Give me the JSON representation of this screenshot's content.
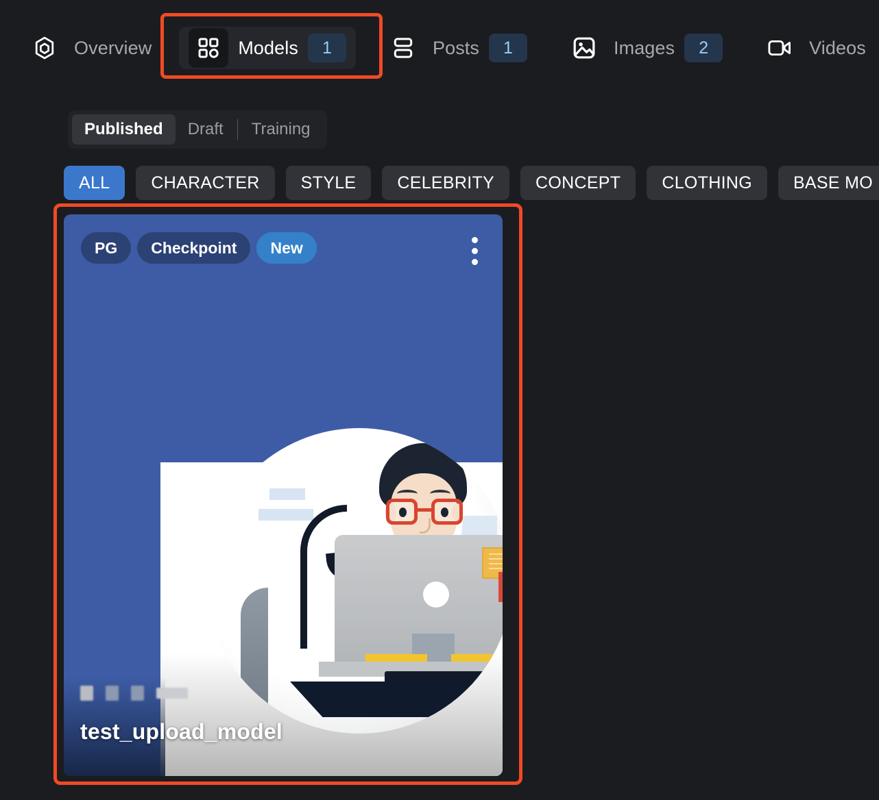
{
  "nav": {
    "items": [
      {
        "label": "Overview",
        "icon": "hexagon-icon",
        "badge": null,
        "active": false
      },
      {
        "label": "Models",
        "icon": "grid-icon",
        "badge": "1",
        "active": true
      },
      {
        "label": "Posts",
        "icon": "posts-icon",
        "badge": "1",
        "active": false
      },
      {
        "label": "Images",
        "icon": "image-icon",
        "badge": "2",
        "active": false
      },
      {
        "label": "Videos",
        "icon": "video-icon",
        "badge": null,
        "active": false
      }
    ]
  },
  "status_tabs": {
    "items": [
      {
        "label": "Published",
        "active": true
      },
      {
        "label": "Draft",
        "active": false
      },
      {
        "label": "Training",
        "active": false
      }
    ]
  },
  "filters": {
    "chips": [
      {
        "label": "ALL",
        "active": true
      },
      {
        "label": "CHARACTER",
        "active": false
      },
      {
        "label": "STYLE",
        "active": false
      },
      {
        "label": "CELEBRITY",
        "active": false
      },
      {
        "label": "CONCEPT",
        "active": false
      },
      {
        "label": "CLOTHING",
        "active": false
      },
      {
        "label": "BASE MO",
        "active": false
      }
    ]
  },
  "model_card": {
    "badges": [
      {
        "label": "PG",
        "style": "dark"
      },
      {
        "label": "Checkpoint",
        "style": "dark"
      },
      {
        "label": "New",
        "style": "accent"
      }
    ],
    "menu_icon": "kebab-menu-icon",
    "title": "test_upload_model"
  },
  "colors": {
    "page_background": "#1b1c20",
    "accent_blue": "#3b78cc",
    "card_blue": "#3d5ca5",
    "badge_navy": "#24364c",
    "badge_text": "#9ecbf2",
    "annotation_red": "#f04a25",
    "chip_background": "#313338",
    "new_badge": "#3581c9"
  }
}
